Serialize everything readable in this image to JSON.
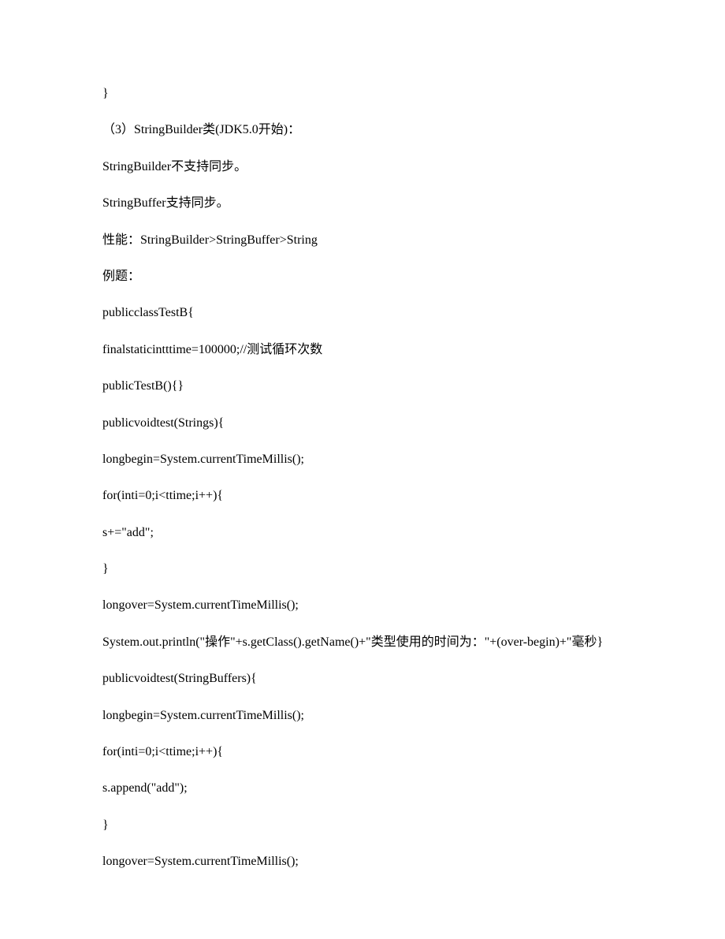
{
  "lines": {
    "l0": "}",
    "l1": "（3）StringBuilder类(JDK5.0开始)：",
    "l2": "StringBuilder不支持同步。",
    "l3": "StringBuffer支持同步。",
    "l4": "性能：StringBuilder>StringBuffer>String",
    "l5": "例题：",
    "l6": "publicclassTestB{",
    "l7": "finalstaticintttime=100000;//测试循环次数",
    "l8": "publicTestB(){}",
    "l9": "publicvoidtest(Strings){",
    "l10": "longbegin=System.currentTimeMillis();",
    "l11": "for(inti=0;i<ttime;i++){",
    "l12": "s+=\"add\";",
    "l13": "}",
    "l14": "longover=System.currentTimeMillis();",
    "l15": "System.out.println(\"操作\"+s.getClass().getName()+\"类型使用的时间为：\"+(over-begin)+\"毫秒}",
    "l16": "publicvoidtest(StringBuffers){",
    "l17": "longbegin=System.currentTimeMillis();",
    "l18": "for(inti=0;i<ttime;i++){",
    "l19": "s.append(\"add\");",
    "l20": "}",
    "l21": "longover=System.currentTimeMillis();"
  }
}
